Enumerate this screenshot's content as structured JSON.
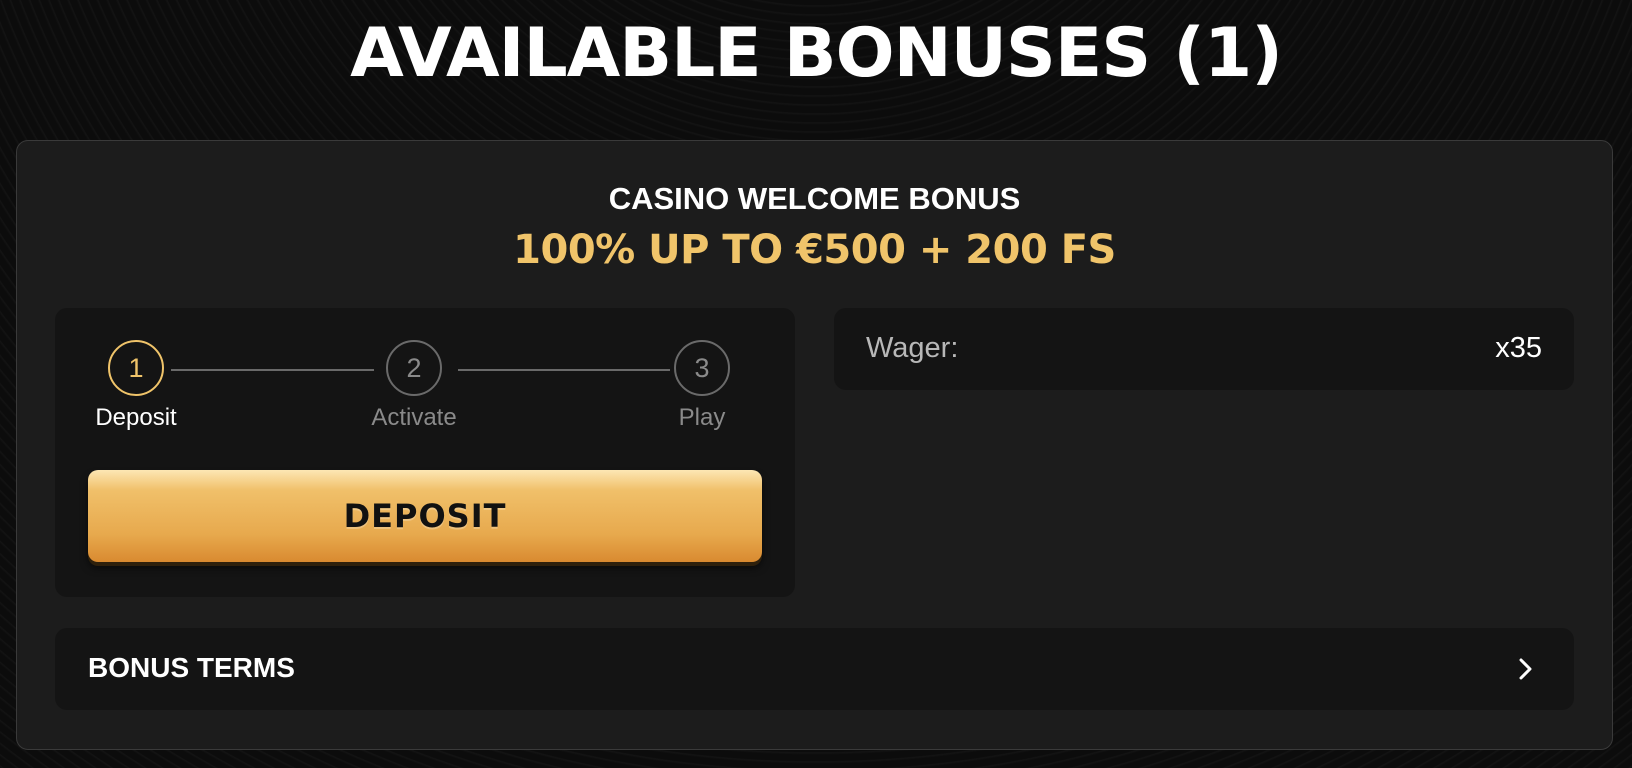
{
  "header": {
    "title": "AVAILABLE BONUSES (1)"
  },
  "bonus": {
    "name": "CASINO WELCOME BONUS",
    "offer": "100% UP TO €500 + 200 FS",
    "steps": [
      {
        "number": "1",
        "label": "Deposit",
        "active": true
      },
      {
        "number": "2",
        "label": "Activate",
        "active": false
      },
      {
        "number": "3",
        "label": "Play",
        "active": false
      }
    ],
    "deposit_button": "DEPOSIT",
    "wager": {
      "label": "Wager:",
      "value": "x35"
    },
    "terms_label": "BONUS TERMS"
  },
  "colors": {
    "accent": "#f0c46a",
    "card_bg": "#1c1c1c",
    "panel_bg": "#141414",
    "inactive": "#8a8a8a"
  },
  "icons": {
    "terms_toggle": "chevron-right-icon"
  }
}
